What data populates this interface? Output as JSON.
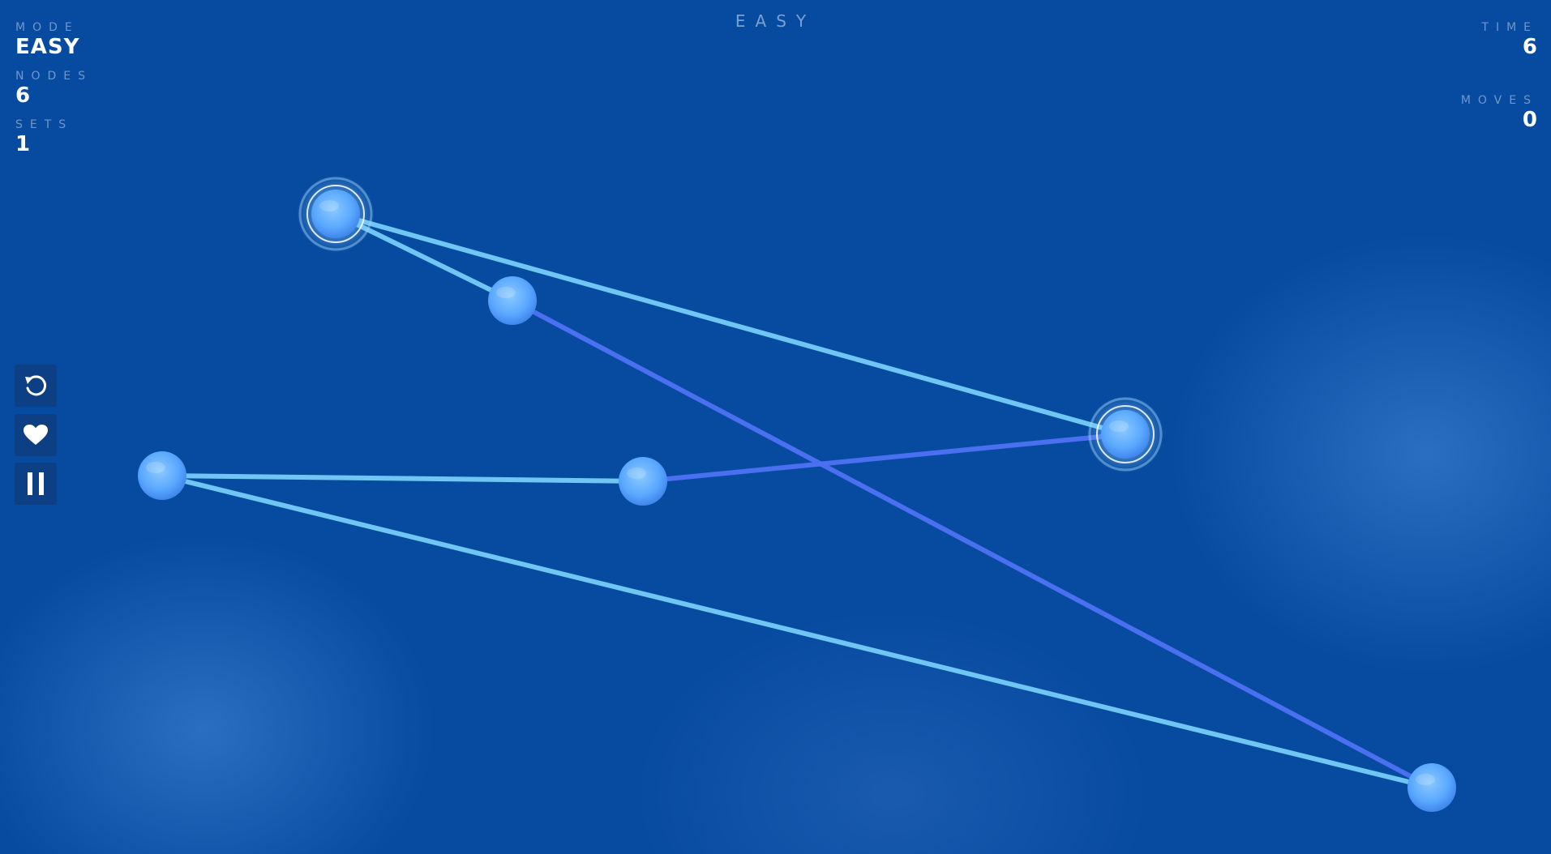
{
  "header": {
    "title": "EASY"
  },
  "stats_left": {
    "mode_label": "MODE",
    "mode_value": "EASY",
    "nodes_label": "NODES",
    "nodes_value": "6",
    "sets_label": "SETS",
    "sets_value": "1"
  },
  "stats_right": {
    "time_label": "TIME",
    "time_value": "6",
    "moves_label": "MOVES",
    "moves_value": "0"
  },
  "controls": [
    {
      "name": "restart",
      "icon": "restart-icon"
    },
    {
      "name": "favorite",
      "icon": "heart-icon"
    },
    {
      "name": "pause",
      "icon": "pause-icon"
    }
  ],
  "colors": {
    "background": "#074ba1",
    "node": "#5aa8ff",
    "edge_light": "#6fc6f2",
    "edge_dark": "#4a6ff0",
    "selected_ring": "#9fd6ff"
  }
}
